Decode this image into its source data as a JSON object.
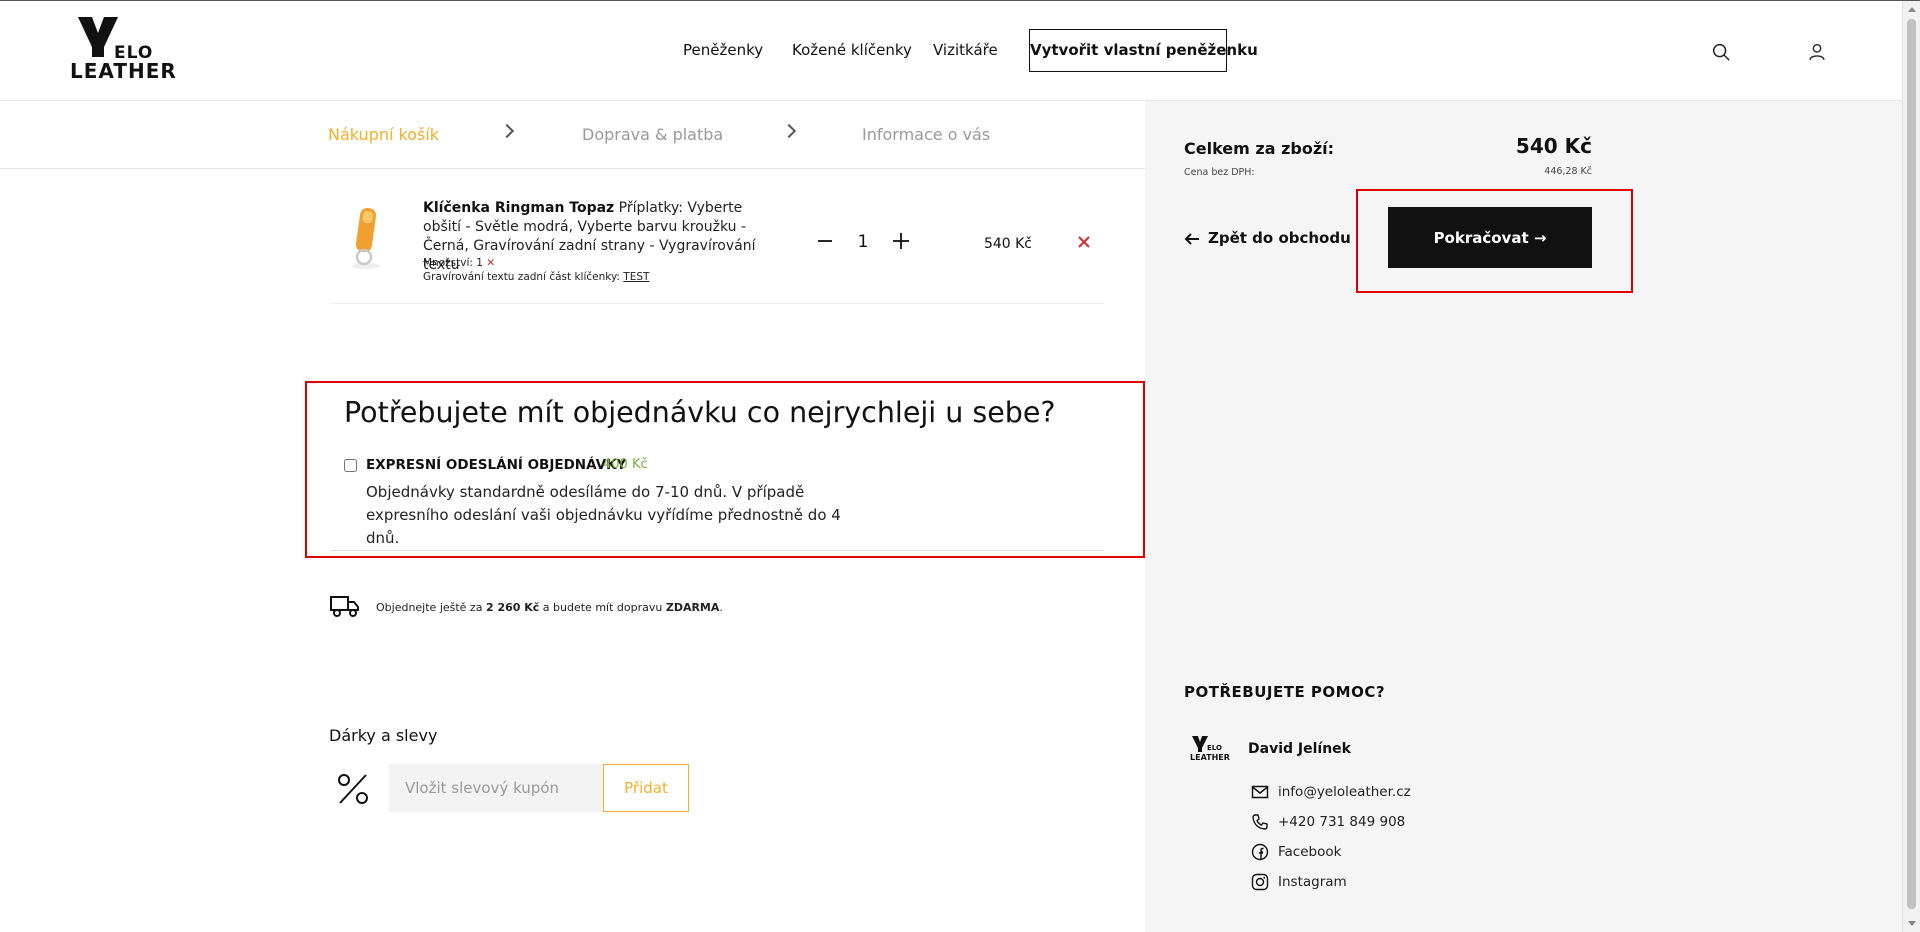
{
  "header": {
    "logo_top": "ELO",
    "logo_bottom": "LEATHER",
    "nav": [
      {
        "label": "Peněženky"
      },
      {
        "label": "Kožené klíčenky"
      },
      {
        "label": "Vizitkáře"
      }
    ],
    "cta_label": "Vytvořit vlastní peněženku",
    "icons": [
      "search-icon",
      "user-icon"
    ]
  },
  "steps": [
    {
      "label": "Nákupní košík",
      "state": "active"
    },
    {
      "label": "Doprava & platba",
      "state": "idle"
    },
    {
      "label": "Informace o vás",
      "state": "idle"
    }
  ],
  "cart": {
    "item": {
      "name": "Klíčenka Ringman Topaz",
      "options": "Příplatky: Vyberte obšití - Světle modrá, Vyberte barvu kroužku - Černá, Gravírování zadní strany - Vygravírování textu",
      "quantity_label": "Množství: 1",
      "engraving_label": "Gravírování textu zadní část klíčenky:",
      "engraving_value": "TEST",
      "quantity": "1",
      "price": "540 Kč"
    }
  },
  "express": {
    "title": "Potřebujete mít objednávku co nejrychleji u sebe?",
    "label": "EXPRESNÍ ODESLÁNÍ OBJEDNÁVKY",
    "price": "400 Kč",
    "description": "Objednávky standardně odesíláme do 7-10 dnů. V případě expresního odeslání vaši objednávku vyřídíme přednostně do 4 dnů."
  },
  "delivery": {
    "prefix": "Objednejte ještě za",
    "amount": "2 260 Kč",
    "middle": "a budete mít dopravu",
    "free": "ZDARMA",
    "suffix": "."
  },
  "coupon": {
    "title": "Dárky a slevy",
    "placeholder": "Vložit slevový kupón",
    "button": "Přidat"
  },
  "summary": {
    "total_label": "Celkem za zboží:",
    "total_value": "540 Kč",
    "vat_label": "Cena bez DPH:",
    "vat_value": "446,28 Kč",
    "back_label": "Zpět do obchodu",
    "continue_label": "Pokračovat →"
  },
  "help": {
    "title": "POTŘEBUJETE POMOC?",
    "logo_top": "ELO",
    "logo_bottom": "LEATHER",
    "name": "David Jelínek",
    "email": "info@yeloleather.cz",
    "phone": "+420 731 849 908",
    "facebook": "Facebook",
    "instagram": "Instagram"
  },
  "colors": {
    "accent": "#f3b02d",
    "express_price": "#7cb342",
    "remove": "#d32f2f",
    "highlight_box": "#e00000",
    "panel_bg": "#f5f5f5"
  }
}
